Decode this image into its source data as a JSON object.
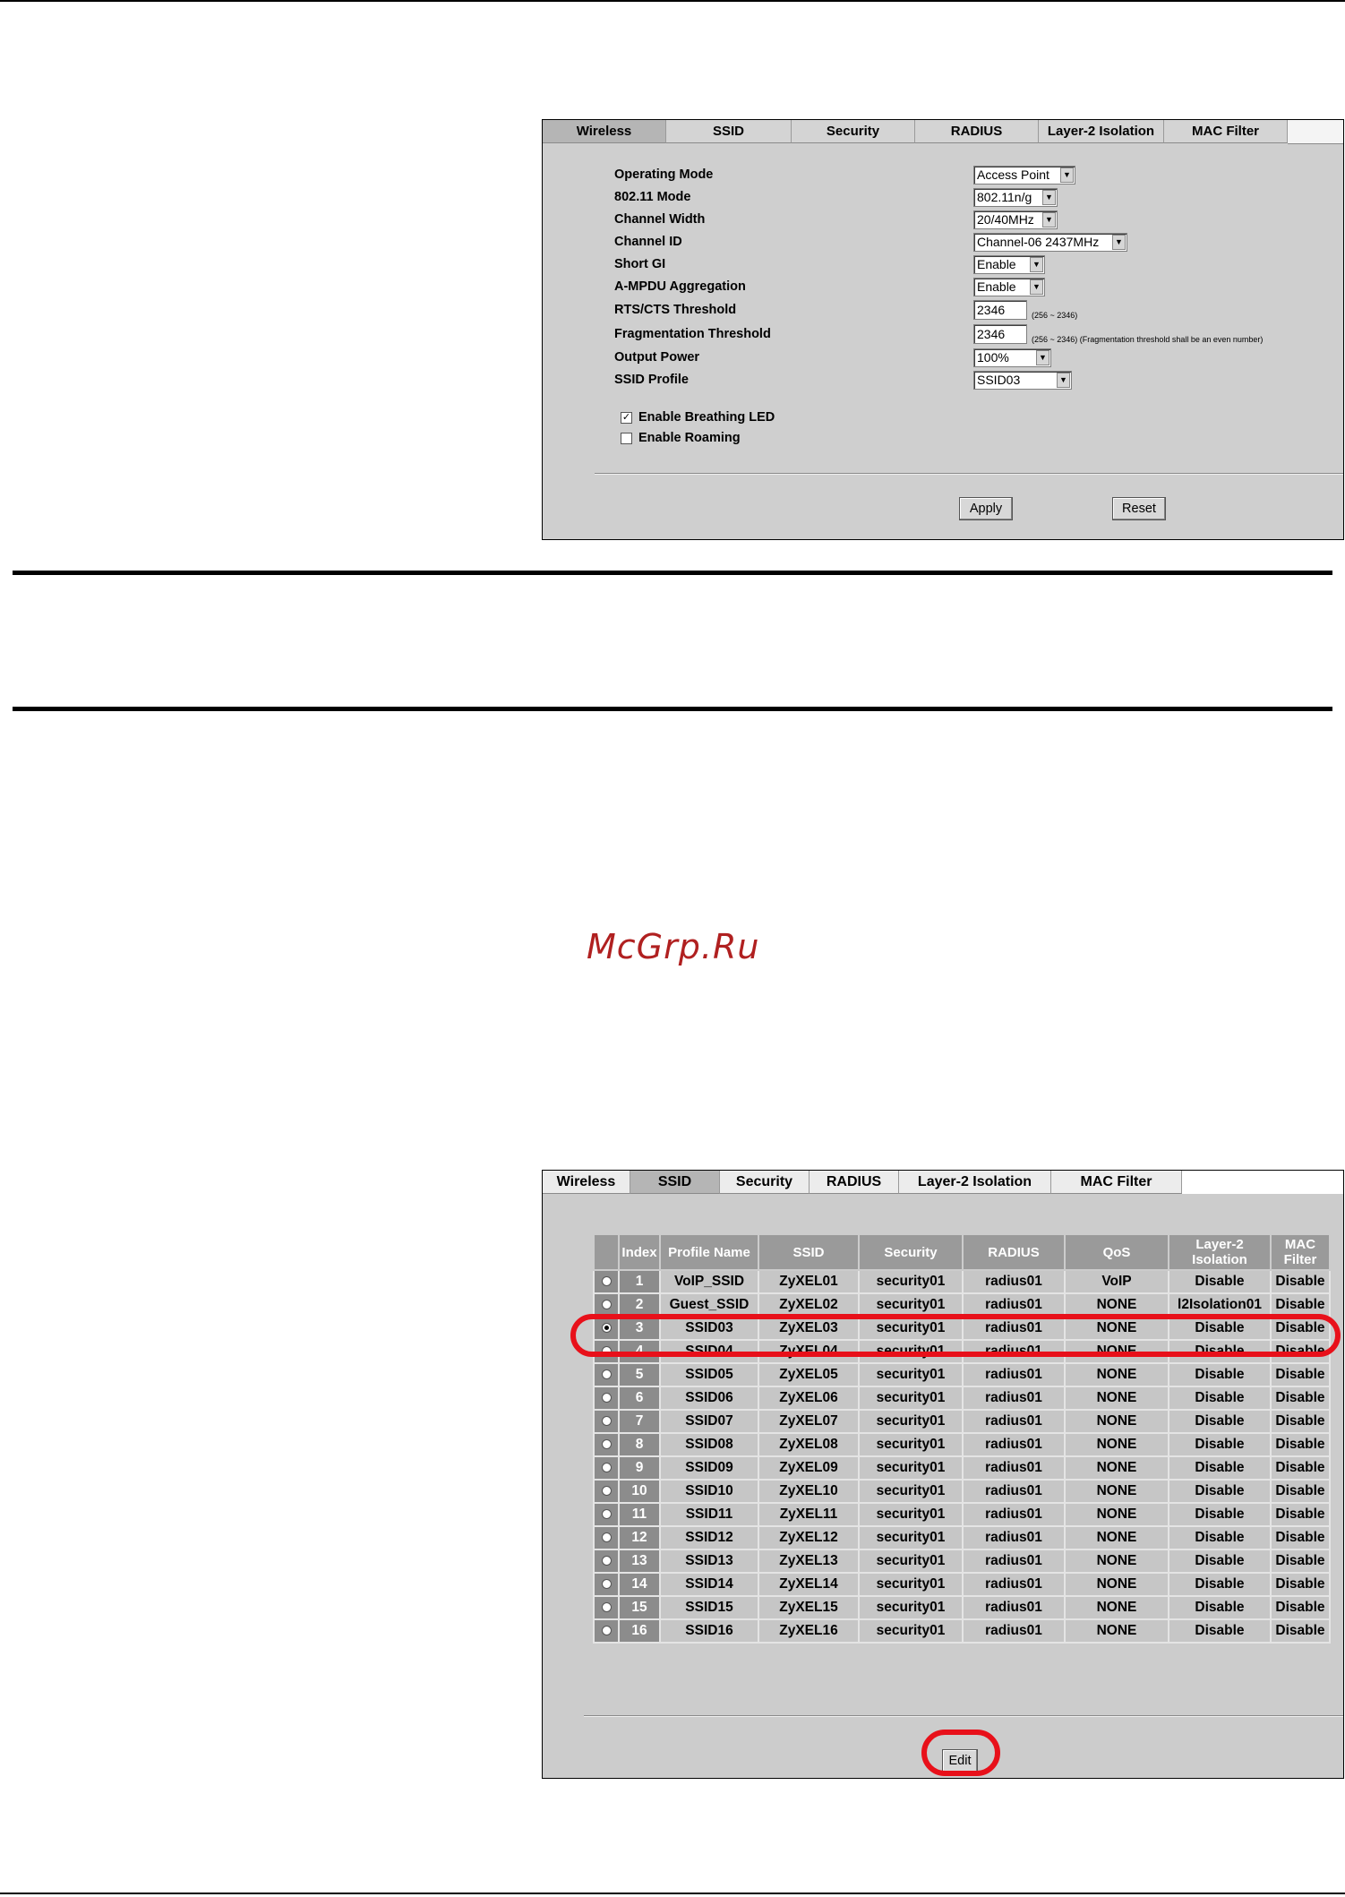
{
  "watermark": "McGrp.Ru",
  "wireless_settings": {
    "tabs": [
      "Wireless",
      "SSID",
      "Security",
      "RADIUS",
      "Layer-2 Isolation",
      "MAC Filter"
    ],
    "active_tab": "Wireless",
    "fields": {
      "operating_mode": {
        "label": "Operating Mode",
        "value": "Access Point"
      },
      "mode_80211": {
        "label": "802.11 Mode",
        "value": "802.11n/g"
      },
      "channel_width": {
        "label": "Channel Width",
        "value": "20/40MHz"
      },
      "channel_id": {
        "label": "Channel ID",
        "value": "Channel-06 2437MHz"
      },
      "short_gi": {
        "label": "Short GI",
        "value": "Enable"
      },
      "ampdu": {
        "label": "A-MPDU Aggregation",
        "value": "Enable"
      },
      "rts_cts": {
        "label": "RTS/CTS Threshold",
        "value": "2346",
        "hint": "(256 ~ 2346)"
      },
      "fragmentation": {
        "label": "Fragmentation Threshold",
        "value": "2346",
        "hint": "(256 ~ 2346) (Fragmentation threshold shall be an even number)"
      },
      "output_power": {
        "label": "Output Power",
        "value": "100%"
      },
      "ssid_profile": {
        "label": "SSID Profile",
        "value": "SSID03"
      }
    },
    "checkboxes": [
      {
        "label": "Enable Breathing LED",
        "checked": true
      },
      {
        "label": "Enable Roaming",
        "checked": false
      }
    ],
    "apply_label": "Apply",
    "reset_label": "Reset"
  },
  "ssid_list": {
    "tabs": [
      "Wireless",
      "SSID",
      "Security",
      "RADIUS",
      "Layer-2 Isolation",
      "MAC Filter"
    ],
    "active_tab": "SSID",
    "columns": [
      "",
      "Index",
      "Profile Name",
      "SSID",
      "Security",
      "RADIUS",
      "QoS",
      "Layer-2 Isolation",
      "MAC Filter"
    ],
    "selected_index": "3",
    "rows": [
      [
        "1",
        "VoIP_SSID",
        "ZyXEL01",
        "security01",
        "radius01",
        "VoIP",
        "Disable",
        "Disable"
      ],
      [
        "2",
        "Guest_SSID",
        "ZyXEL02",
        "security01",
        "radius01",
        "NONE",
        "l2Isolation01",
        "Disable"
      ],
      [
        "3",
        "SSID03",
        "ZyXEL03",
        "security01",
        "radius01",
        "NONE",
        "Disable",
        "Disable"
      ],
      [
        "4",
        "SSID04",
        "ZyXEL04",
        "security01",
        "radius01",
        "NONE",
        "Disable",
        "Disable"
      ],
      [
        "5",
        "SSID05",
        "ZyXEL05",
        "security01",
        "radius01",
        "NONE",
        "Disable",
        "Disable"
      ],
      [
        "6",
        "SSID06",
        "ZyXEL06",
        "security01",
        "radius01",
        "NONE",
        "Disable",
        "Disable"
      ],
      [
        "7",
        "SSID07",
        "ZyXEL07",
        "security01",
        "radius01",
        "NONE",
        "Disable",
        "Disable"
      ],
      [
        "8",
        "SSID08",
        "ZyXEL08",
        "security01",
        "radius01",
        "NONE",
        "Disable",
        "Disable"
      ],
      [
        "9",
        "SSID09",
        "ZyXEL09",
        "security01",
        "radius01",
        "NONE",
        "Disable",
        "Disable"
      ],
      [
        "10",
        "SSID10",
        "ZyXEL10",
        "security01",
        "radius01",
        "NONE",
        "Disable",
        "Disable"
      ],
      [
        "11",
        "SSID11",
        "ZyXEL11",
        "security01",
        "radius01",
        "NONE",
        "Disable",
        "Disable"
      ],
      [
        "12",
        "SSID12",
        "ZyXEL12",
        "security01",
        "radius01",
        "NONE",
        "Disable",
        "Disable"
      ],
      [
        "13",
        "SSID13",
        "ZyXEL13",
        "security01",
        "radius01",
        "NONE",
        "Disable",
        "Disable"
      ],
      [
        "14",
        "SSID14",
        "ZyXEL14",
        "security01",
        "radius01",
        "NONE",
        "Disable",
        "Disable"
      ],
      [
        "15",
        "SSID15",
        "ZyXEL15",
        "security01",
        "radius01",
        "NONE",
        "Disable",
        "Disable"
      ],
      [
        "16",
        "SSID16",
        "ZyXEL16",
        "security01",
        "radius01",
        "NONE",
        "Disable",
        "Disable"
      ]
    ],
    "edit_label": "Edit",
    "highlight_color": "#e8101a"
  }
}
